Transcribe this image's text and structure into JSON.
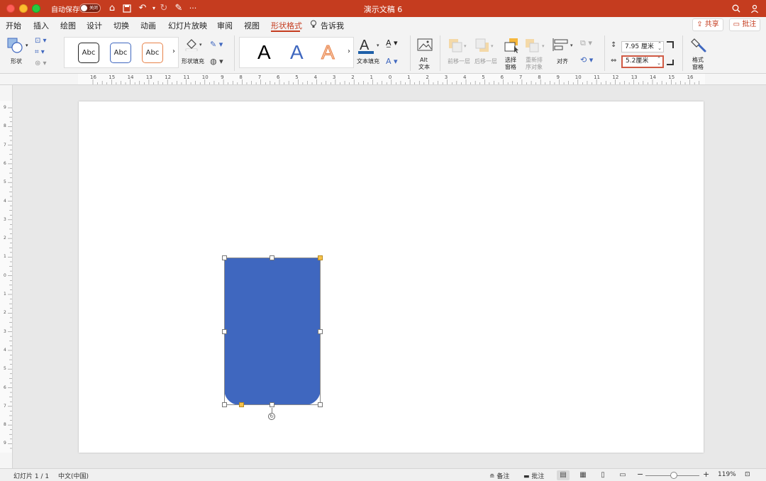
{
  "titlebar": {
    "autosave_label": "自动保存",
    "autosave_state": "关闭",
    "doc_title": "演示文稿 6",
    "more": "···"
  },
  "menu": {
    "tabs": [
      "开始",
      "插入",
      "绘图",
      "设计",
      "切换",
      "动画",
      "幻灯片放映",
      "审阅",
      "视图",
      "形状格式",
      "告诉我"
    ],
    "active_tab": "形状格式",
    "share": "共享",
    "comments": "批注"
  },
  "ribbon": {
    "shape_label": "形状",
    "style_samples": [
      "Abc",
      "Abc",
      "Abc"
    ],
    "shape_fill_label": "形状填充",
    "wordart_samples": [
      "A",
      "A",
      "A"
    ],
    "text_fill_label": "文本填充",
    "alt_text_line1": "Alt",
    "alt_text_line2": "文本",
    "bring_forward": "前移一层",
    "send_backward": "后移一层",
    "selection_pane_line1": "选择",
    "selection_pane_line2": "窗格",
    "reorder_line1": "重新排",
    "reorder_line2": "序对象",
    "align_label": "对齐",
    "height_value": "7.95 厘米",
    "width_value": "5.2厘米",
    "format_pane_line1": "格式",
    "format_pane_line2": "窗格"
  },
  "ruler": {
    "top_numbers": [
      "16",
      "15",
      "14",
      "13",
      "12",
      "11",
      "10",
      "9",
      "8",
      "7",
      "6",
      "5",
      "4",
      "3",
      "2",
      "1",
      "0",
      "1",
      "2",
      "3",
      "4",
      "5",
      "6",
      "7",
      "8",
      "9",
      "10",
      "11",
      "12",
      "13",
      "14",
      "15",
      "16"
    ],
    "left_numbers": [
      "9",
      "8",
      "7",
      "6",
      "5",
      "4",
      "3",
      "2",
      "1",
      "0",
      "1",
      "2",
      "3",
      "4",
      "5",
      "6",
      "7",
      "8",
      "9"
    ]
  },
  "statusbar": {
    "slide_info": "幻灯片 1 / 1",
    "language": "中文(中国)",
    "notes": "备注",
    "comments": "批注",
    "zoom": "119%"
  },
  "colors": {
    "accent": "#c53c1f",
    "shape_fill": "#3f67bf"
  }
}
